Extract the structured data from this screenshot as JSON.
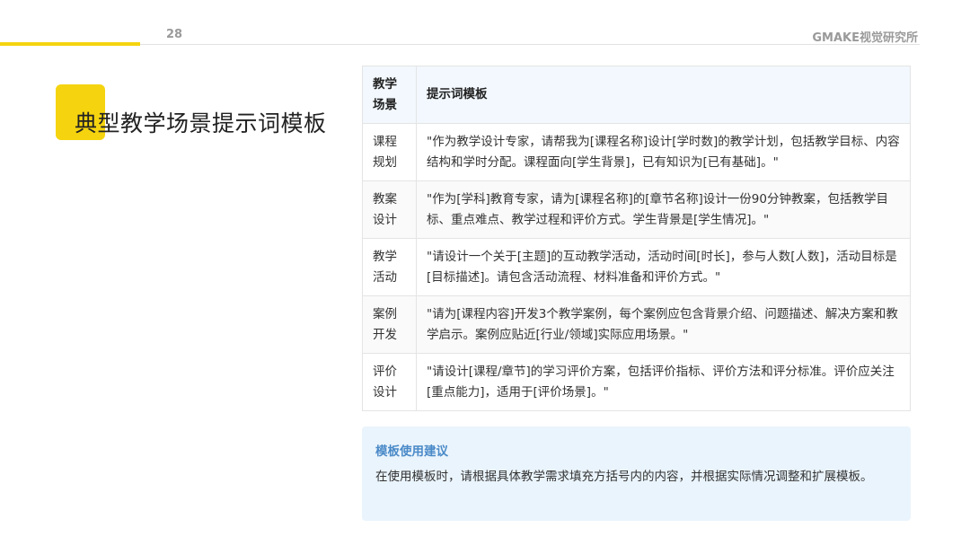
{
  "header": {
    "page_number": "28",
    "brand": "GMAKE视觉研究所"
  },
  "title": "典型教学场景提示词模板",
  "table": {
    "headers": [
      "教学场景",
      "提示词模板"
    ],
    "rows": [
      {
        "scene": "课程规划",
        "template": "\"作为教学设计专家，请帮我为[课程名称]设计[学时数]的教学计划，包括教学目标、内容结构和学时分配。课程面向[学生背景]，已有知识为[已有基础]。\""
      },
      {
        "scene": "教案设计",
        "template": "\"作为[学科]教育专家，请为[课程名称]的[章节名称]设计一份90分钟教案，包括教学目标、重点难点、教学过程和评价方式。学生背景是[学生情况]。\""
      },
      {
        "scene": "教学活动",
        "template": "\"请设计一个关于[主题]的互动教学活动，活动时间[时长]，参与人数[人数]，活动目标是[目标描述]。请包含活动流程、材料准备和评价方式。\""
      },
      {
        "scene": "案例开发",
        "template": "\"请为[课程内容]开发3个教学案例，每个案例应包含背景介绍、问题描述、解决方案和教学启示。案例应贴近[行业/领域]实际应用场景。\""
      },
      {
        "scene": "评价设计",
        "template": "\"请设计[课程/章节]的学习评价方案，包括评价指标、评价方法和评分标准。评价应关注[重点能力]，适用于[评价场景]。\""
      }
    ]
  },
  "tip": {
    "title": "模板使用建议",
    "text": "在使用模板时，请根据具体教学需求填充方括号内的内容，并根据实际情况调整和扩展模板。"
  },
  "colors": {
    "accent_yellow": "#f5d40f",
    "tip_title_blue": "#4a8ac8",
    "tip_bg": "#eaf4fc",
    "header_row_bg": "#f2f8fd"
  }
}
